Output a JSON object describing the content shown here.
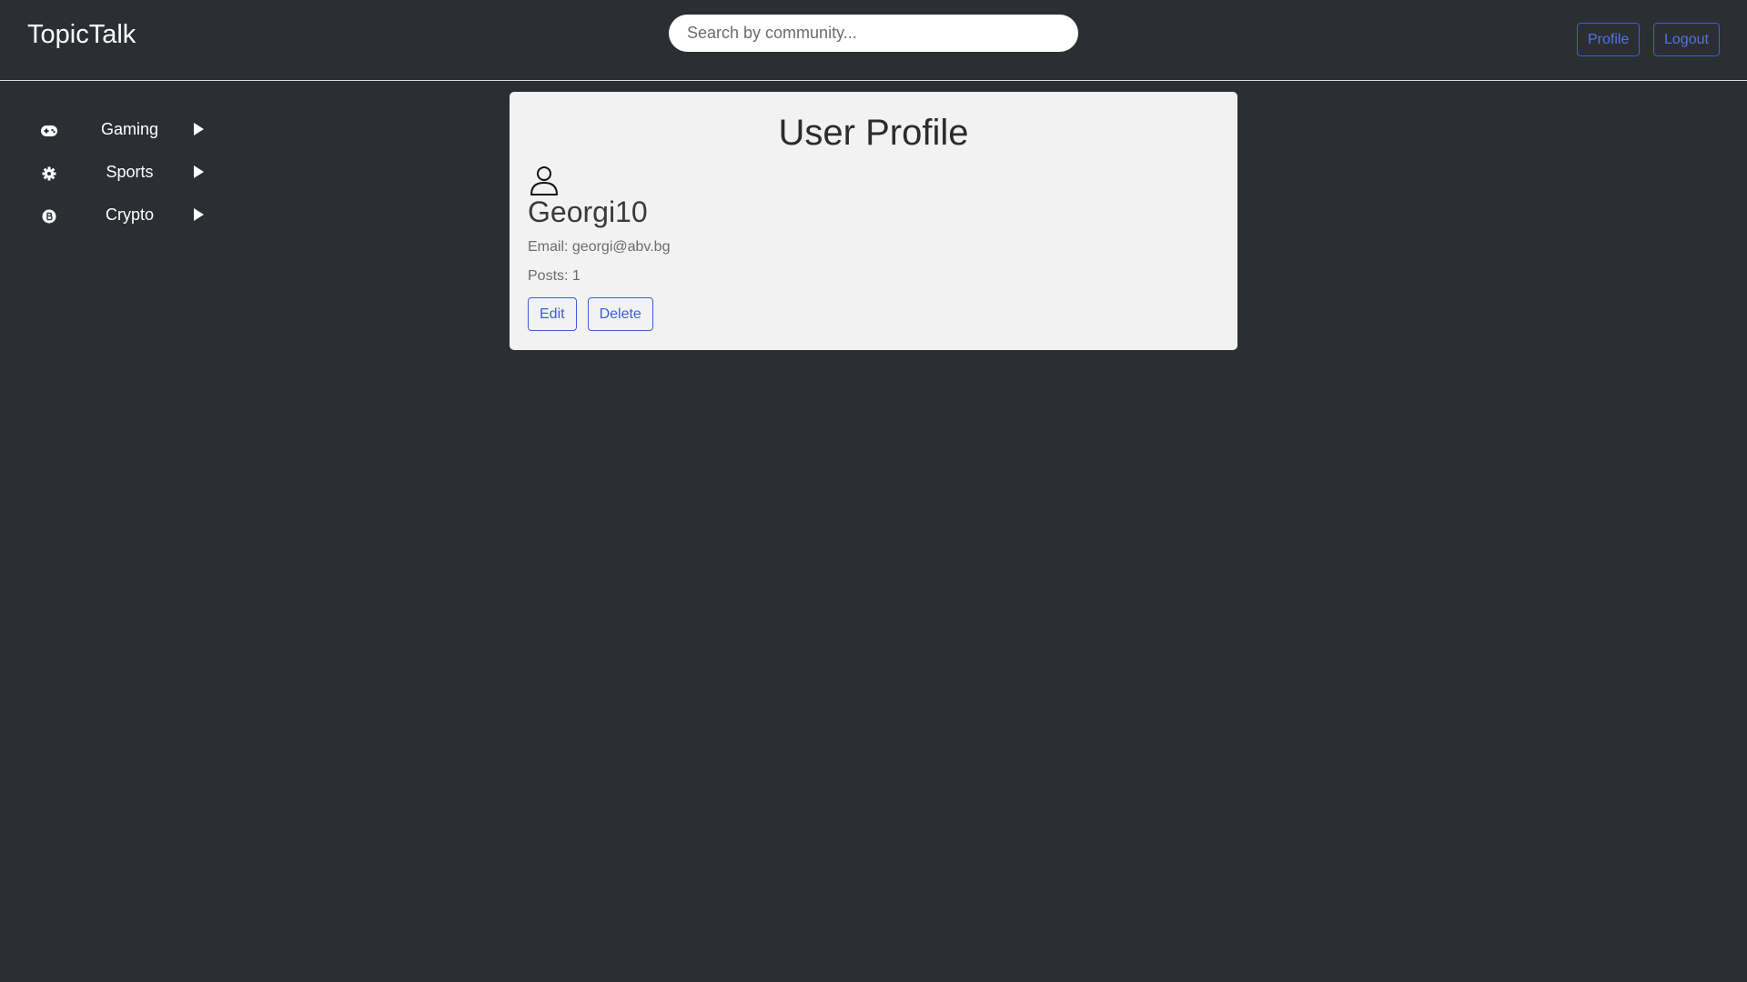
{
  "app": {
    "brand": "TopicTalk"
  },
  "header": {
    "search_placeholder": "Search by community...",
    "search_value": "",
    "profile_label": "Profile",
    "logout_label": "Logout"
  },
  "sidebar": {
    "items": [
      {
        "label": "Gaming",
        "icon": "gamepad-icon"
      },
      {
        "label": "Sports",
        "icon": "gear-icon"
      },
      {
        "label": "Crypto",
        "icon": "bitcoin-icon"
      }
    ]
  },
  "profile": {
    "title": "User Profile",
    "avatar_icon": "user-icon",
    "username": "Georgi10",
    "email_text": "Email: georgi@abv.bg",
    "posts_text": "Posts: 1",
    "edit_label": "Edit",
    "delete_label": "Delete"
  },
  "colors": {
    "background": "#2b2f33",
    "card": "#f2f2f2",
    "accent": "#3a5fd6"
  }
}
